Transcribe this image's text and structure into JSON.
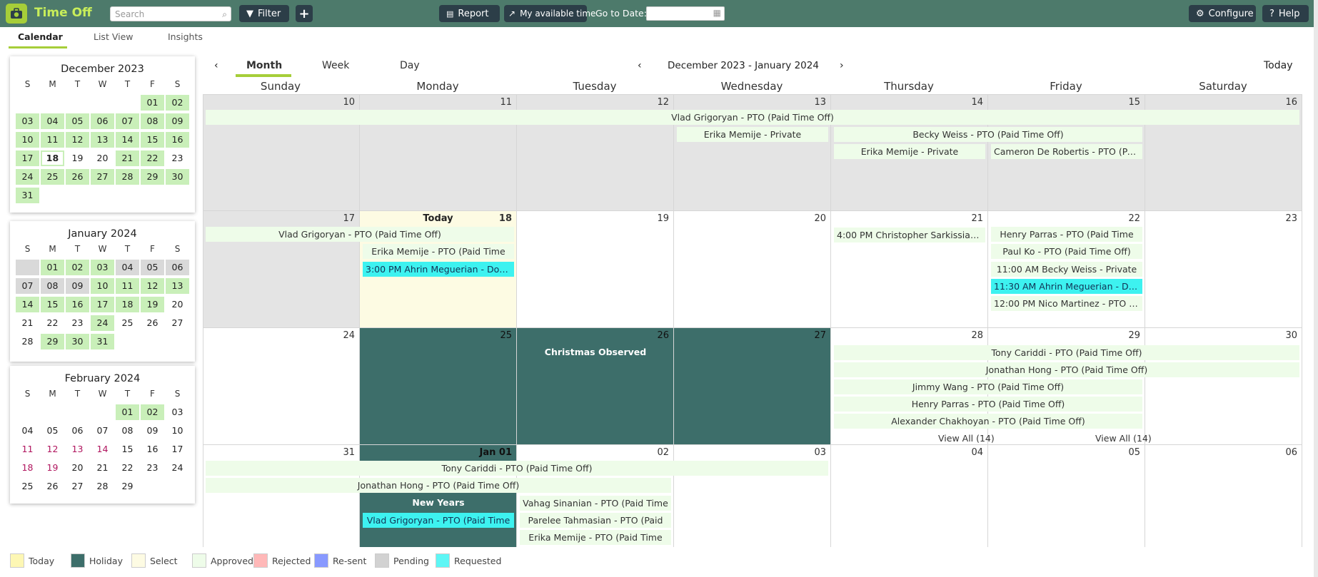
{
  "app": {
    "title": "Time Off"
  },
  "toolbar": {
    "search_placeholder": "Search",
    "filter_label": "Filter",
    "add_label": "+",
    "report_label": "Report",
    "available_label": "My available time",
    "goto_label": "Go to Date:",
    "configure_label": "Configure",
    "help_label": "Help"
  },
  "tabs": [
    "Calendar",
    "List View",
    "Insights"
  ],
  "calendar_header": {
    "views": [
      "Month",
      "Week",
      "Day"
    ],
    "range": "December 2023 - January 2024",
    "today_label": "Today",
    "dow": [
      "Sunday",
      "Monday",
      "Tuesday",
      "Wednesday",
      "Thursday",
      "Friday",
      "Saturday"
    ]
  },
  "mini_dow": [
    "S",
    "M",
    "T",
    "W",
    "T",
    "F",
    "S"
  ],
  "mini_cals": [
    {
      "title": "December 2023",
      "days": [
        "",
        "",
        "",
        "",
        "",
        "01",
        "02",
        "03",
        "04",
        "05",
        "06",
        "07",
        "08",
        "09",
        "10",
        "11",
        "12",
        "13",
        "14",
        "15",
        "16",
        "17",
        "18",
        "19",
        "20",
        "21",
        "22",
        "23",
        "24",
        "25",
        "26",
        "27",
        "28",
        "29",
        "30",
        "31"
      ],
      "green": [
        "01",
        "02",
        "03",
        "04",
        "05",
        "06",
        "07",
        "08",
        "09",
        "10",
        "11",
        "12",
        "13",
        "14",
        "15",
        "16",
        "17",
        "21",
        "22",
        "24",
        "25",
        "26",
        "27",
        "28",
        "29",
        "30",
        "31"
      ],
      "selected": "18"
    },
    {
      "title": "January 2024",
      "days": [
        "",
        "01",
        "02",
        "03",
        "04",
        "05",
        "06",
        "07",
        "08",
        "09",
        "10",
        "11",
        "12",
        "13",
        "14",
        "15",
        "16",
        "17",
        "18",
        "19",
        "20",
        "21",
        "22",
        "23",
        "24",
        "25",
        "26",
        "27",
        "28",
        "29",
        "30",
        "31"
      ],
      "green": [
        "01",
        "02",
        "03",
        "10",
        "11",
        "12",
        "13",
        "14",
        "15",
        "16",
        "17",
        "18",
        "19",
        "24",
        "29",
        "30",
        "31"
      ],
      "grey": [
        "",
        "04",
        "05",
        "06",
        "07",
        "08",
        "09"
      ],
      "selected": ""
    },
    {
      "title": "February 2024",
      "days": [
        "",
        "",
        "",
        "",
        "01",
        "02",
        "03",
        "04",
        "05",
        "06",
        "07",
        "08",
        "09",
        "10",
        "11",
        "12",
        "13",
        "14",
        "15",
        "16",
        "17",
        "18",
        "19",
        "20",
        "21",
        "22",
        "23",
        "24",
        "25",
        "26",
        "27",
        "28",
        "29"
      ],
      "green": [
        "01",
        "02"
      ],
      "red": [
        "11",
        "12",
        "13",
        "14",
        "18",
        "19"
      ],
      "selected": ""
    }
  ],
  "weeks": [
    {
      "days": [
        "10",
        "11",
        "12",
        "13",
        "14",
        "15",
        "16"
      ]
    },
    {
      "days": [
        "17",
        "18",
        "19",
        "20",
        "21",
        "22",
        "23"
      ]
    },
    {
      "days": [
        "24",
        "25",
        "26",
        "27",
        "28",
        "29",
        "30"
      ]
    },
    {
      "days": [
        "31",
        "Jan 01",
        "02",
        "03",
        "04",
        "05",
        "06"
      ]
    }
  ],
  "today_text": "Today",
  "events": {
    "w1_vlad": "Vlad Grigoryan - PTO (Paid Time Off)",
    "w1_erika_private": "Erika Memije - Private",
    "w1_becky": "Becky Weiss - PTO (Paid Time Off)",
    "w1_erika_private2": "Erika Memije - Private",
    "w1_cameron": "Cameron De Robertis - PTO (Paid",
    "w2_vlad": "Vlad Grigoryan - PTO (Paid Time Off)",
    "w2_erika": "Erika Memije - PTO (Paid Time",
    "w2_ahrin": "3:00 PM Ahrin Meguerian - Docto...",
    "w2_christopher": "4:00 PM Christopher Sarkissian - ...",
    "w2_henry": "Henry Parras - PTO (Paid Time",
    "w2_paul": "Paul Ko - PTO (Paid Time Off)",
    "w2_becky": "11:00 AM Becky Weiss - Private",
    "w2_ahrin2": "11:30 AM Ahrin Meguerian - Docto...",
    "w2_nico": "12:00 PM Nico Martinez - PTO (Pai...",
    "w3_christmas": "Christmas Observed",
    "w3_tony": "Tony Cariddi - PTO (Paid Time Off)",
    "w3_jonathan": "Jonathan Hong - PTO (Paid Time Off)",
    "w3_jimmy": "Jimmy Wang - PTO (Paid Time Off)",
    "w3_henry": "Henry Parras - PTO (Paid Time Off)",
    "w3_alexander": "Alexander Chakhoyan - PTO (Paid Time Off)",
    "w3_viewall1": "View All (14)",
    "w3_viewall2": "View All (14)",
    "w4_tony": "Tony Cariddi - PTO (Paid Time Off)",
    "w4_jonathan": "Jonathan Hong - PTO (Paid Time Off)",
    "w4_newyears": "New Years",
    "w4_vlad": "Vlad Grigoryan - PTO (Paid Time",
    "w4_vahag": "Vahag Sinanian - PTO (Paid Time",
    "w4_parelee": "Parelee Tahmasian - PTO (Paid",
    "w4_erika": "Erika Memije - PTO (Paid Time"
  },
  "legend": [
    {
      "label": "Today",
      "color": "#fdf7b4"
    },
    {
      "label": "Holiday",
      "color": "#3d6e6a"
    },
    {
      "label": "Select",
      "color": "#fdfbe3"
    },
    {
      "label": "Approved",
      "color": "#eefce9"
    },
    {
      "label": "Rejected",
      "color": "#ffb8b8"
    },
    {
      "label": "Re-sent",
      "color": "#8899ff"
    },
    {
      "label": "Pending",
      "color": "#d2d2d2"
    },
    {
      "label": "Requested",
      "color": "#5ef6f5"
    }
  ],
  "colors": {
    "topbar": "#4d7a6b",
    "accent": "#a6ce39",
    "holiday": "#3d6e6a"
  }
}
